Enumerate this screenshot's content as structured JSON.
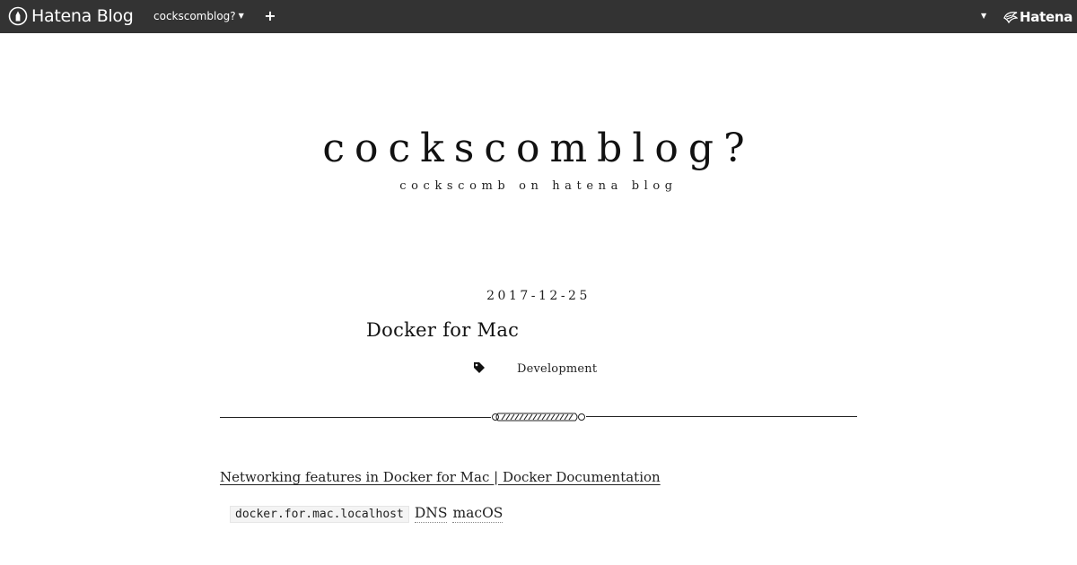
{
  "topbar": {
    "brand_label": "Hatena Blog",
    "blog_menu_label": "cockscomblog?",
    "add_label": "+",
    "hatena_label": "Hatena",
    "background": "#333333"
  },
  "header": {
    "title": "cockscomblog?",
    "description": "cockscomb on hatena blog"
  },
  "entry": {
    "date": "2017-12-25",
    "title": "Docker for Mac",
    "category": "Development",
    "body_link": "Networking features in Docker for Mac | Docker Documentation",
    "code": "docker.for.mac.localhost",
    "keywords": [
      "DNS",
      "macOS"
    ]
  },
  "icons": {
    "brand": "hatena-blog-pen-icon",
    "blog_menu": "chevron-down-icon",
    "add": "plus-icon",
    "account": "chevron-down-icon",
    "hatena": "hatena-bird-icon",
    "category": "tag-icon"
  }
}
